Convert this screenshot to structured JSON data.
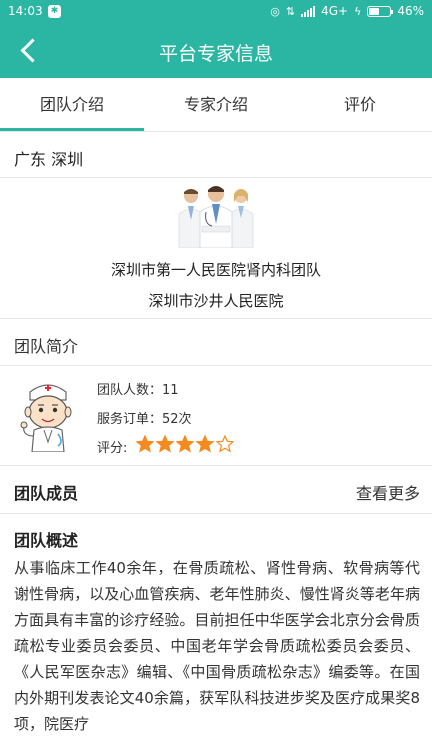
{
  "status_bar": {
    "time": "14:03",
    "network": "4G+",
    "battery": "46%",
    "battery_level": 0.46
  },
  "header": {
    "title": "平台专家信息"
  },
  "tabs": [
    {
      "label": "团队介绍",
      "active": true
    },
    {
      "label": "专家介绍",
      "active": false
    },
    {
      "label": "评价",
      "active": false
    }
  ],
  "region": "广东 深圳",
  "team": {
    "name": "深圳市第一人民医院肾内科团队",
    "hospital": "深圳市沙井人民医院"
  },
  "intro": {
    "title": "团队简介",
    "member_count": "团队人数：11",
    "service_orders": "服务订单：52次",
    "rating_label": "评分:",
    "rating": 4,
    "rating_max": 5
  },
  "members": {
    "title": "团队成员",
    "see_more": "查看更多"
  },
  "overview": {
    "title": "团队概述",
    "text": "从事临床工作40余年，在骨质疏松、肾性骨病、软骨病等代谢性骨病，以及心血管疾病、老年性肺炎、慢性肾炎等老年病方面具有丰富的诊疗经验。目前担任中华医学会北京分会骨质疏松专业委员会委员、中国老年学会骨质疏松委员会委员、《人民军医杂志》编辑、《中国骨质疏松杂志》编委等。在国内外期刊发表论文40余篇，获军队科技进步奖及医疗成果奖8项，院医疗"
  },
  "colors": {
    "brand": "#2bb6a3",
    "star": "#f58a1f"
  }
}
